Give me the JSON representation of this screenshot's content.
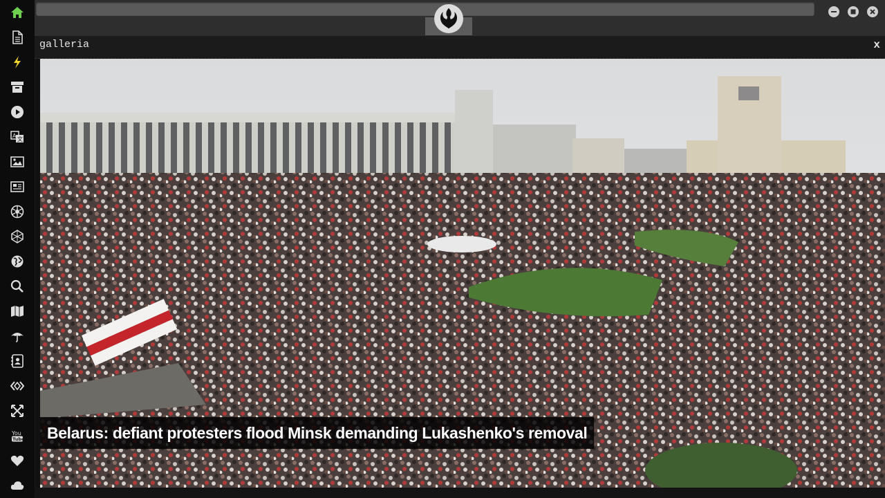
{
  "sidebar": {
    "items": [
      {
        "name": "home-icon"
      },
      {
        "name": "document-icon"
      },
      {
        "name": "lightning-icon"
      },
      {
        "name": "archive-icon"
      },
      {
        "name": "play-icon"
      },
      {
        "name": "translate-icon"
      },
      {
        "name": "image-icon"
      },
      {
        "name": "news-icon"
      },
      {
        "name": "rebel-icon"
      },
      {
        "name": "empire-icon"
      },
      {
        "name": "globe-icon"
      },
      {
        "name": "search-icon"
      },
      {
        "name": "map-icon"
      },
      {
        "name": "umbrella-icon"
      },
      {
        "name": "contact-card-icon"
      },
      {
        "name": "code-icon"
      },
      {
        "name": "expand-icon"
      },
      {
        "name": "youtube-icon"
      },
      {
        "name": "heart-icon"
      },
      {
        "name": "cloud-icon"
      }
    ],
    "active_color": "#6fcf4f",
    "accent_color": "#f2d22e"
  },
  "topbar": {
    "logo": "rebel-alliance-icon",
    "window_controls": [
      "minimize-icon",
      "maximize-icon",
      "close-icon"
    ]
  },
  "panel": {
    "title": "galleria",
    "close_label": "x"
  },
  "gallery": {
    "caption": "Belarus: defiant protesters flood Minsk demanding Lukashenko's removal"
  }
}
